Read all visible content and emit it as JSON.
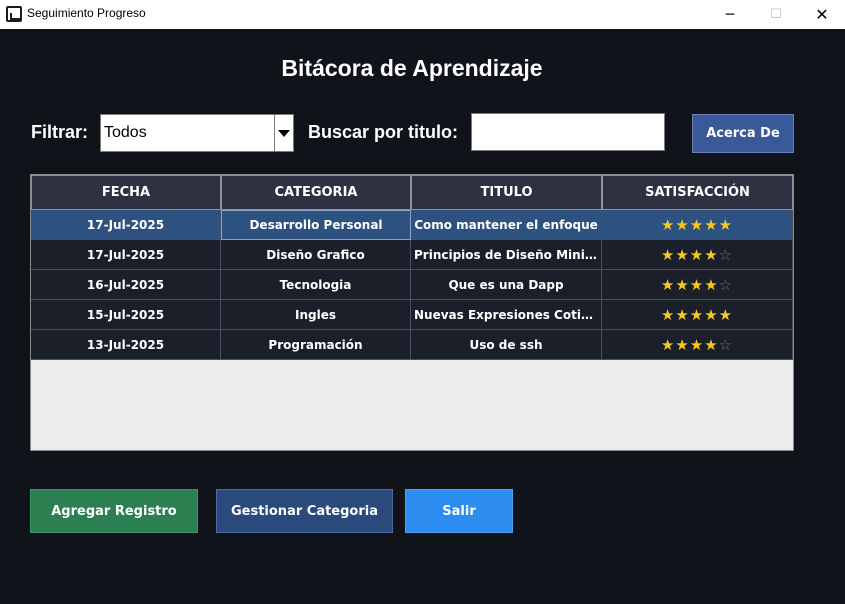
{
  "window": {
    "title": "Seguimiento Progreso",
    "min_label": "─",
    "max_label": "☐",
    "close_label": "✕"
  },
  "page_title": "Bitácora de Aprendizaje",
  "filter": {
    "label": "Filtrar:",
    "value": "Todos"
  },
  "search": {
    "label": "Buscar por titulo:",
    "value": ""
  },
  "about_button": "Acerca De",
  "table": {
    "headers": [
      "FECHA",
      "CATEGORIA",
      "TITULO",
      "SATISFACCIÓN"
    ],
    "rows": [
      {
        "fecha": "17-Jul-2025",
        "categoria": "Desarrollo Personal",
        "titulo": "Como mantener el enfoque",
        "stars": 5,
        "stars_text_on": "★★★★★",
        "stars_text_off": ""
      },
      {
        "fecha": "17-Jul-2025",
        "categoria": "Diseño Grafico",
        "titulo": "Principios de Diseño Minimalista",
        "stars": 4,
        "stars_text_on": "★★★★",
        "stars_text_off": "☆"
      },
      {
        "fecha": "16-Jul-2025",
        "categoria": "Tecnologia",
        "titulo": "Que es una Dapp",
        "stars": 4,
        "stars_text_on": "★★★★",
        "stars_text_off": "☆"
      },
      {
        "fecha": "15-Jul-2025",
        "categoria": "Ingles",
        "titulo": "Nuevas Expresiones Cotidianas",
        "stars": 5,
        "stars_text_on": "★★★★★",
        "stars_text_off": ""
      },
      {
        "fecha": "13-Jul-2025",
        "categoria": "Programación",
        "titulo": "Uso de ssh",
        "stars": 4,
        "stars_text_on": "★★★★",
        "stars_text_off": "☆"
      }
    ]
  },
  "buttons": {
    "add": "Agregar Registro",
    "categories": "Gestionar Categoria",
    "exit": "Salir"
  },
  "colors": {
    "background": "#11131b",
    "selected_row": "#2e5280",
    "add": "#2b7f50",
    "categories": "#294a7b",
    "exit": "#2d8cf0",
    "star": "#f8c81c"
  }
}
